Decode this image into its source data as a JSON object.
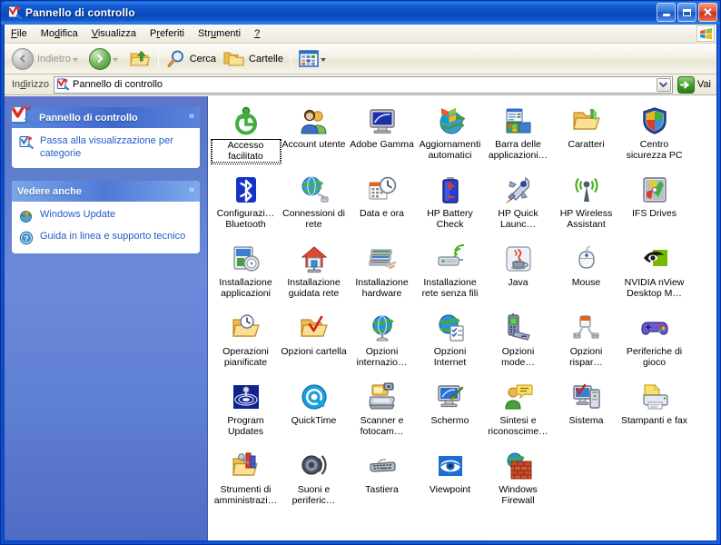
{
  "window": {
    "title": "Pannello di controllo",
    "title_icon": "control-panel-icon",
    "minimize_label": "_",
    "maximize_label": "",
    "close_label": "✕"
  },
  "menubar": {
    "items": [
      {
        "label": "File",
        "accel": "F"
      },
      {
        "label": "Modifica",
        "accel": "d"
      },
      {
        "label": "Visualizza",
        "accel": "V"
      },
      {
        "label": "Preferiti",
        "accel": "r"
      },
      {
        "label": "Strumenti",
        "accel": "u"
      },
      {
        "label": "?",
        "accel": "?"
      }
    ],
    "brand_icon": "windows-flag-icon"
  },
  "toolbar": {
    "back_label": "Indietro",
    "forward_label": "",
    "up_label": "",
    "search_label": "Cerca",
    "folders_label": "Cartelle",
    "views_label": ""
  },
  "address": {
    "label": "Indirizzo",
    "value": "Pannello di controllo",
    "placeholder": "Pannello di controllo",
    "go_label": "Vai"
  },
  "sidebar": {
    "panels": [
      {
        "title": "Pannello di controllo",
        "icon": "control-panel-icon",
        "collapse_glyph": "«",
        "links": [
          {
            "label": "Passa alla visualizzazione per categorie",
            "icon": "category-view-icon"
          }
        ]
      },
      {
        "title": "Vedere anche",
        "icon": "",
        "collapse_glyph": "«",
        "links": [
          {
            "label": "Windows Update",
            "icon": "windows-update-icon"
          },
          {
            "label": "Guida in linea e supporto tecnico",
            "icon": "help-support-icon"
          }
        ]
      }
    ]
  },
  "content": {
    "items": [
      {
        "label": "Accesso facilitato",
        "icon": "accessibility-icon",
        "selected": true
      },
      {
        "label": "Account utente",
        "icon": "user-accounts-icon",
        "selected": false
      },
      {
        "label": "Adobe Gamma",
        "icon": "adobe-gamma-icon",
        "selected": false
      },
      {
        "label": "Aggiornamenti automatici",
        "icon": "automatic-updates-icon",
        "selected": false
      },
      {
        "label": "Barra delle applicazioni…",
        "icon": "taskbar-start-menu-icon",
        "selected": false
      },
      {
        "label": "Caratteri",
        "icon": "fonts-folder-icon",
        "selected": false
      },
      {
        "label": "Centro sicurezza PC",
        "icon": "security-center-icon",
        "selected": false
      },
      {
        "label": "Configurazi… Bluetooth",
        "icon": "bluetooth-icon",
        "selected": false
      },
      {
        "label": "Connessioni di rete",
        "icon": "network-connections-icon",
        "selected": false
      },
      {
        "label": "Data e ora",
        "icon": "date-time-icon",
        "selected": false
      },
      {
        "label": "HP Battery Check",
        "icon": "hp-battery-check-icon",
        "selected": false
      },
      {
        "label": "HP Quick Launc…",
        "icon": "hp-quick-launch-icon",
        "selected": false
      },
      {
        "label": "HP Wireless Assistant",
        "icon": "hp-wireless-assistant-icon",
        "selected": false
      },
      {
        "label": "IFS Drives",
        "icon": "ifs-drives-icon",
        "selected": false
      },
      {
        "label": "Installazione applicazioni",
        "icon": "add-remove-programs-icon",
        "selected": false
      },
      {
        "label": "Installazione guidata rete",
        "icon": "network-setup-wizard-icon",
        "selected": false
      },
      {
        "label": "Installazione hardware",
        "icon": "add-hardware-icon",
        "selected": false
      },
      {
        "label": "Installazione rete senza fili",
        "icon": "wireless-network-setup-icon",
        "selected": false
      },
      {
        "label": "Java",
        "icon": "java-icon",
        "selected": false
      },
      {
        "label": "Mouse",
        "icon": "mouse-icon",
        "selected": false
      },
      {
        "label": "NVIDIA nView Desktop M…",
        "icon": "nvidia-nview-icon",
        "selected": false
      },
      {
        "label": "Operazioni pianificate",
        "icon": "scheduled-tasks-icon",
        "selected": false
      },
      {
        "label": "Opzioni cartella",
        "icon": "folder-options-icon",
        "selected": false
      },
      {
        "label": "Opzioni internazio…",
        "icon": "regional-options-icon",
        "selected": false
      },
      {
        "label": "Opzioni Internet",
        "icon": "internet-options-icon",
        "selected": false
      },
      {
        "label": "Opzioni mode…",
        "icon": "phone-modem-options-icon",
        "selected": false
      },
      {
        "label": "Opzioni rispar…",
        "icon": "power-options-icon",
        "selected": false
      },
      {
        "label": "Periferiche di gioco",
        "icon": "game-controllers-icon",
        "selected": false
      },
      {
        "label": "Program Updates",
        "icon": "program-updates-icon",
        "selected": false
      },
      {
        "label": "QuickTime",
        "icon": "quicktime-icon",
        "selected": false
      },
      {
        "label": "Scanner e fotocam…",
        "icon": "scanners-cameras-icon",
        "selected": false
      },
      {
        "label": "Schermo",
        "icon": "display-icon",
        "selected": false
      },
      {
        "label": "Sintesi e riconoscime…",
        "icon": "speech-icon",
        "selected": false
      },
      {
        "label": "Sistema",
        "icon": "system-icon",
        "selected": false
      },
      {
        "label": "Stampanti e fax",
        "icon": "printers-faxes-icon",
        "selected": false
      },
      {
        "label": "Strumenti di amministrazi…",
        "icon": "administrative-tools-icon",
        "selected": false
      },
      {
        "label": "Suoni e periferic…",
        "icon": "sounds-audio-icon",
        "selected": false
      },
      {
        "label": "Tastiera",
        "icon": "keyboard-icon",
        "selected": false
      },
      {
        "label": "Viewpoint",
        "icon": "viewpoint-icon",
        "selected": false
      },
      {
        "label": "Windows Firewall",
        "icon": "windows-firewall-icon",
        "selected": false
      }
    ]
  },
  "colors": {
    "title_blue": "#0b50c6",
    "sidebar_blue": "#5d7bc9",
    "link_blue": "#215dc6",
    "chrome_beige": "#ece9d8"
  }
}
